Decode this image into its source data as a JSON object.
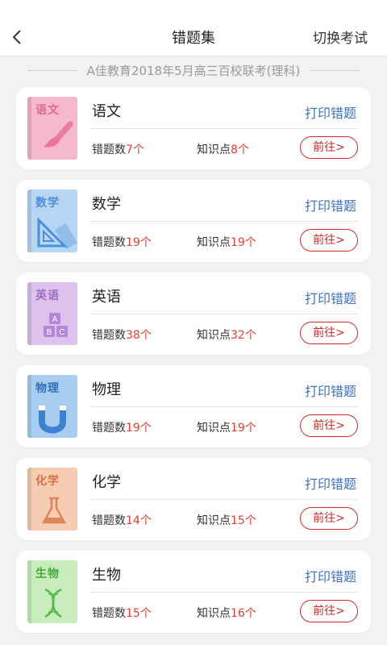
{
  "header": {
    "back_icon": "chevron-left-icon",
    "title": "错题集",
    "switch_label": "切换考试"
  },
  "exam_name": "A佳教育2018年5月高三百校联考(理科)",
  "subjects": [
    {
      "id": "chinese",
      "name": "语文",
      "book_title": "语文",
      "icon": "brush-icon",
      "color": "#f4b9cd",
      "accent": "#e8759a",
      "title_color": "#e06a8f",
      "print_label": "打印错题",
      "mistakes_label": "错题数",
      "mistakes": "7个",
      "points_label": "知识点",
      "points": "8个",
      "goto_label": "前往>"
    },
    {
      "id": "math",
      "name": "数学",
      "book_title": "数学",
      "icon": "ruler-triangle-icon",
      "color": "#b7d6f3",
      "accent": "#4b8fd6",
      "title_color": "#4b8fd6",
      "print_label": "打印错题",
      "mistakes_label": "错题数",
      "mistakes": "19个",
      "points_label": "知识点",
      "points": "19个",
      "goto_label": "前往>"
    },
    {
      "id": "english",
      "name": "英语",
      "book_title": "英语",
      "icon": "abc-blocks-icon",
      "color": "#dcc2ec",
      "accent": "#b487d6",
      "title_color": "#a16cc7",
      "print_label": "打印错题",
      "mistakes_label": "错题数",
      "mistakes": "38个",
      "points_label": "知识点",
      "points": "32个",
      "goto_label": "前往>"
    },
    {
      "id": "physics",
      "name": "物理",
      "book_title": "物理",
      "icon": "magnet-icon",
      "color": "#a9cdf0",
      "accent": "#3d82d0",
      "title_color": "#2e6fbd",
      "print_label": "打印错题",
      "mistakes_label": "错题数",
      "mistakes": "19个",
      "points_label": "知识点",
      "points": "19个",
      "goto_label": "前往>"
    },
    {
      "id": "chemistry",
      "name": "化学",
      "book_title": "化学",
      "icon": "flask-icon",
      "color": "#f6cdb3",
      "accent": "#e0855a",
      "title_color": "#d8703f",
      "print_label": "打印错题",
      "mistakes_label": "错题数",
      "mistakes": "14个",
      "points_label": "知识点",
      "points": "15个",
      "goto_label": "前往>"
    },
    {
      "id": "biology",
      "name": "生物",
      "book_title": "生物",
      "icon": "dna-icon",
      "color": "#c9ecbd",
      "accent": "#58b84a",
      "title_color": "#46a83a",
      "print_label": "打印错题",
      "mistakes_label": "错题数",
      "mistakes": "15个",
      "points_label": "知识点",
      "points": "16个",
      "goto_label": "前往>"
    }
  ]
}
